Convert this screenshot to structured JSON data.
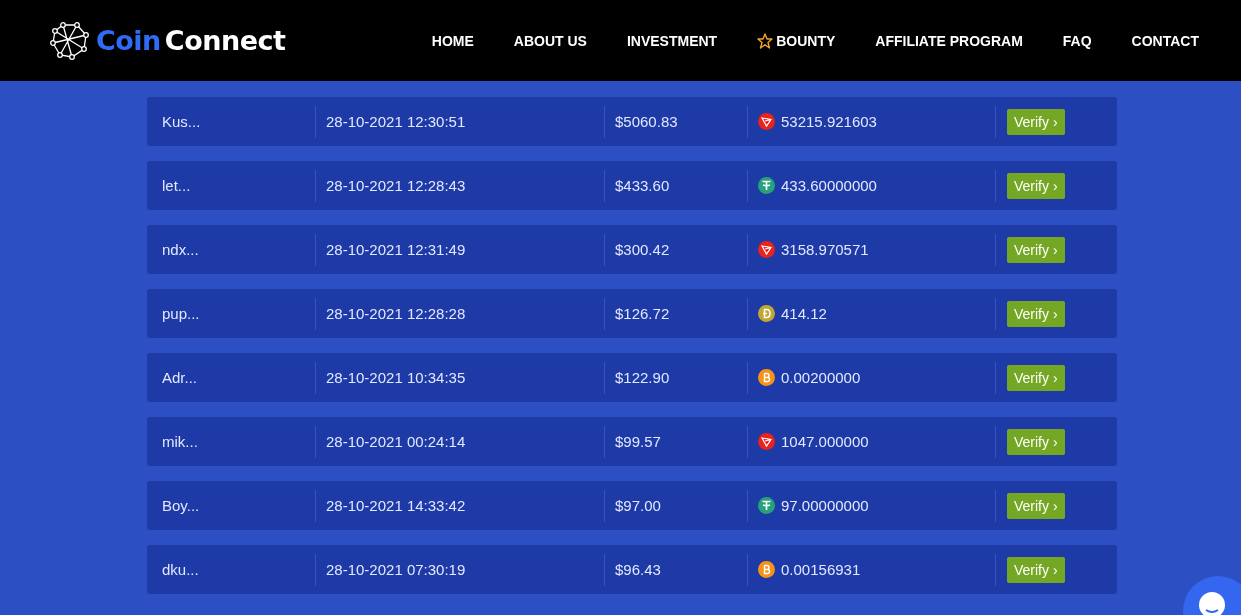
{
  "brand": {
    "part_1": "Coin",
    "part_2": "Connect"
  },
  "nav": [
    {
      "label": "HOME",
      "kind": "plain"
    },
    {
      "label": "ABOUT US",
      "kind": "plain"
    },
    {
      "label": "INVESTMENT",
      "kind": "plain"
    },
    {
      "label": "BOUNTY",
      "kind": "starred"
    },
    {
      "label": "AFFILIATE PROGRAM",
      "kind": "plain"
    },
    {
      "label": "FAQ",
      "kind": "plain"
    },
    {
      "label": "CONTACT",
      "kind": "plain"
    }
  ],
  "rows": [
    {
      "user": "Kus...",
      "date": "28-10-2021 12:30:51",
      "amount": "$5060.83",
      "kind": "tron",
      "crypto_amount": "53215.921603",
      "button": "Verify ›"
    },
    {
      "user": "let...",
      "date": "28-10-2021 12:28:43",
      "amount": "$433.60",
      "kind": "tether",
      "crypto_amount": "433.60000000",
      "button": "Verify ›"
    },
    {
      "user": "ndx...",
      "date": "28-10-2021 12:31:49",
      "amount": "$300.42",
      "kind": "tron",
      "crypto_amount": "3158.970571",
      "button": "Verify ›"
    },
    {
      "user": "pup...",
      "date": "28-10-2021 12:28:28",
      "amount": "$126.72",
      "kind": "doge",
      "crypto_amount": "414.12",
      "button": "Verify ›"
    },
    {
      "user": "Adr...",
      "date": "28-10-2021 10:34:35",
      "amount": "$122.90",
      "kind": "bitcoin",
      "crypto_amount": "0.00200000",
      "button": "Verify ›"
    },
    {
      "user": "mik...",
      "date": "28-10-2021 00:24:14",
      "amount": "$99.57",
      "kind": "tron",
      "crypto_amount": "1047.000000",
      "button": "Verify ›"
    },
    {
      "user": "Boy...",
      "date": "28-10-2021 14:33:42",
      "amount": "$97.00",
      "kind": "tether",
      "crypto_amount": "97.00000000",
      "button": "Verify ›"
    },
    {
      "user": "dku...",
      "date": "28-10-2021 07:30:19",
      "amount": "$96.43",
      "kind": "bitcoin",
      "crypto_amount": "0.00156931",
      "button": "Verify ›"
    }
  ]
}
